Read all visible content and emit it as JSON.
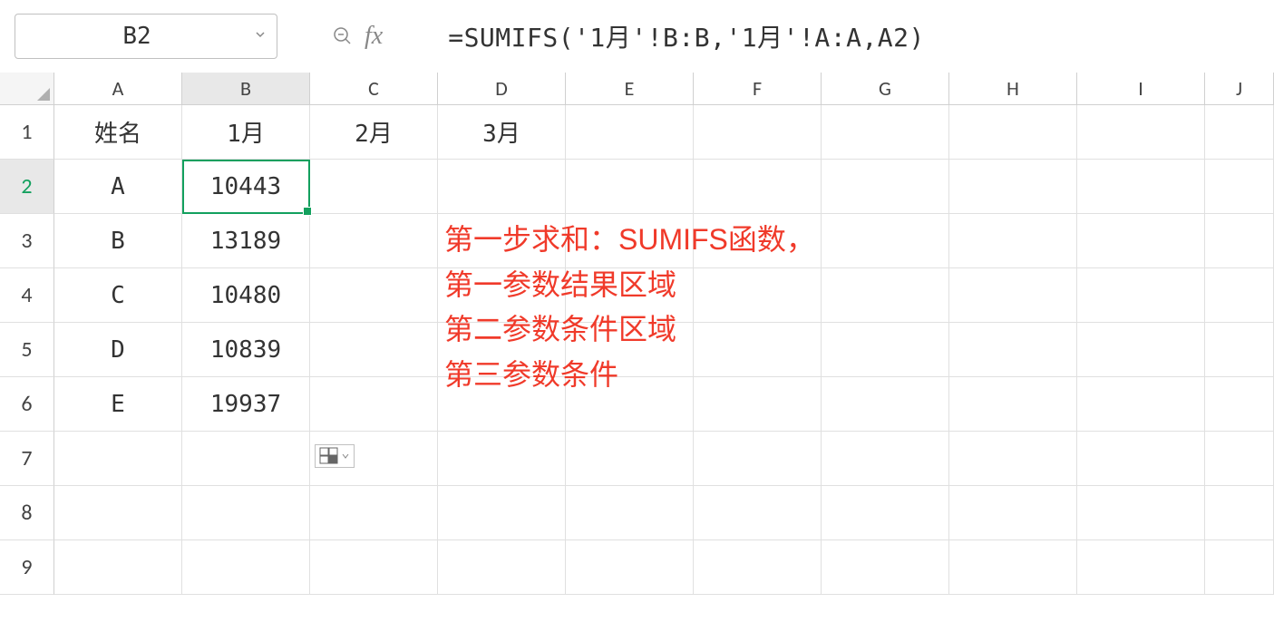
{
  "nameBox": {
    "value": "B2"
  },
  "formulaBar": {
    "value": "=SUMIFS('1月'!B:B,'1月'!A:A,A2)"
  },
  "columns": [
    "A",
    "B",
    "C",
    "D",
    "E",
    "F",
    "G",
    "H",
    "I",
    "J"
  ],
  "rows": [
    "1",
    "2",
    "3",
    "4",
    "5",
    "6",
    "7",
    "8",
    "9"
  ],
  "activeCell": {
    "row": 2,
    "col": "B"
  },
  "cells": {
    "A1": "姓名",
    "B1": "1月",
    "C1": "2月",
    "D1": "3月",
    "A2": "A",
    "B2": "10443",
    "A3": "B",
    "B3": "13189",
    "A4": "C",
    "B4": "10480",
    "A5": "D",
    "B5": "10839",
    "A6": "E",
    "B6": "19937"
  },
  "annotation": {
    "lines": [
      "第一步求和：SUMIFS函数，",
      "第一参数结果区域",
      "第二参数条件区域",
      "第三参数条件"
    ]
  }
}
